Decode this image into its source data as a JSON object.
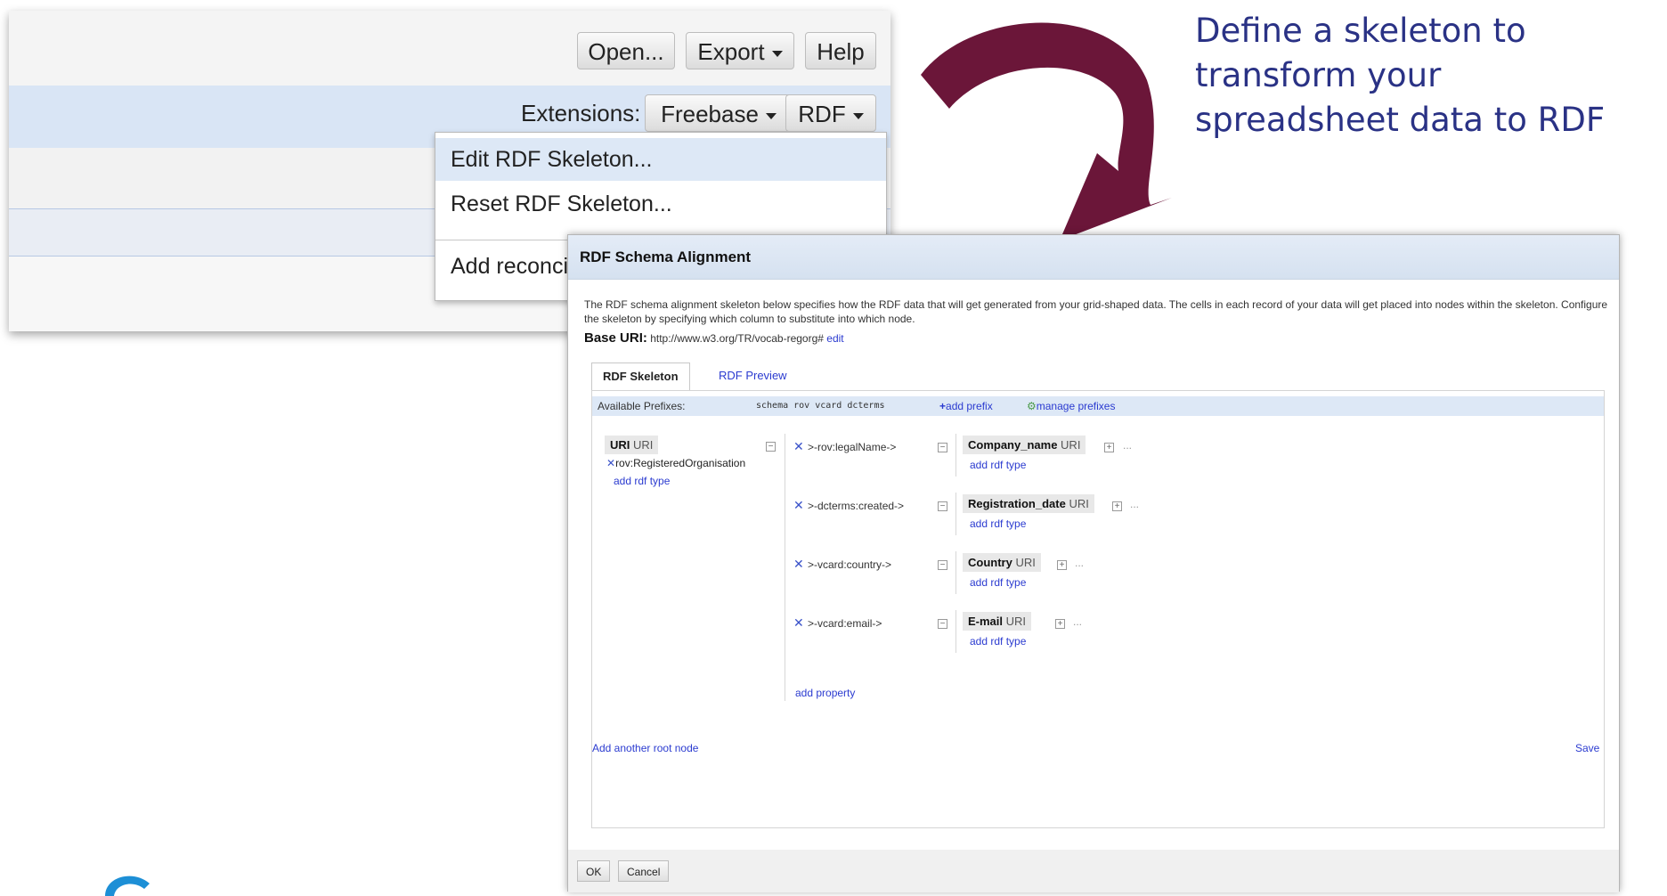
{
  "toolbar": {
    "open_label": "Open...",
    "export_label": "Export",
    "help_label": "Help",
    "extensions_label": "Extensions:",
    "freebase_label": "Freebase",
    "rdf_label": "RDF"
  },
  "rdf_menu": {
    "items": [
      {
        "label": "Edit RDF Skeleton..."
      },
      {
        "label": "Reset RDF Skeleton..."
      },
      {
        "label": "Add reconcili"
      }
    ]
  },
  "annotation": {
    "text_line1": "Define a skeleton to",
    "text_line2": "transform your",
    "text_line3": "spreadsheet data to RDF"
  },
  "dialog": {
    "title": "RDF Schema Alignment",
    "description": "The RDF schema alignment skeleton below specifies how the RDF data that will get generated from your grid-shaped data. The cells in each record of your data will get placed into nodes within the skeleton. Configure the skeleton by specifying which column to substitute into which node.",
    "base_uri_label": "Base URI:",
    "base_uri_value": "http://www.w3.org/TR/vocab-regorg#",
    "base_uri_edit": "edit",
    "tabs": [
      {
        "label": "RDF Skeleton",
        "active": true
      },
      {
        "label": "RDF Preview",
        "active": false
      }
    ],
    "prefixes_label": "Available Prefixes:",
    "prefixes": "schema rov vcard dcterms",
    "add_prefix_label": "add prefix",
    "manage_prefixes_label": "manage prefixes",
    "root_node": {
      "name": "URI",
      "type_label": "URI",
      "rdf_type": "rov:RegisteredOrganisation",
      "add_rdf_type": "add rdf type"
    },
    "properties": [
      {
        "property": ">-rov:legalName->",
        "column": "Company_name",
        "type": "URI",
        "add_rdf_type": "add rdf type"
      },
      {
        "property": ">-dcterms:created->",
        "column": "Registration_date",
        "type": "URI",
        "add_rdf_type": "add rdf type"
      },
      {
        "property": ">-vcard:country->",
        "column": "Country",
        "type": "URI",
        "add_rdf_type": "add rdf type"
      },
      {
        "property": ">-vcard:email->",
        "column": "E-mail",
        "type": "URI",
        "add_rdf_type": "add rdf type"
      }
    ],
    "add_property_label": "add property",
    "add_root_node_label": "Add another root node",
    "save_label": "Save",
    "ok_label": "OK",
    "cancel_label": "Cancel"
  },
  "colors": {
    "annotation": "#2a3285",
    "arrow": "#6b1639",
    "link": "#2b3bd0",
    "menu_highlight": "#dde8f6"
  }
}
